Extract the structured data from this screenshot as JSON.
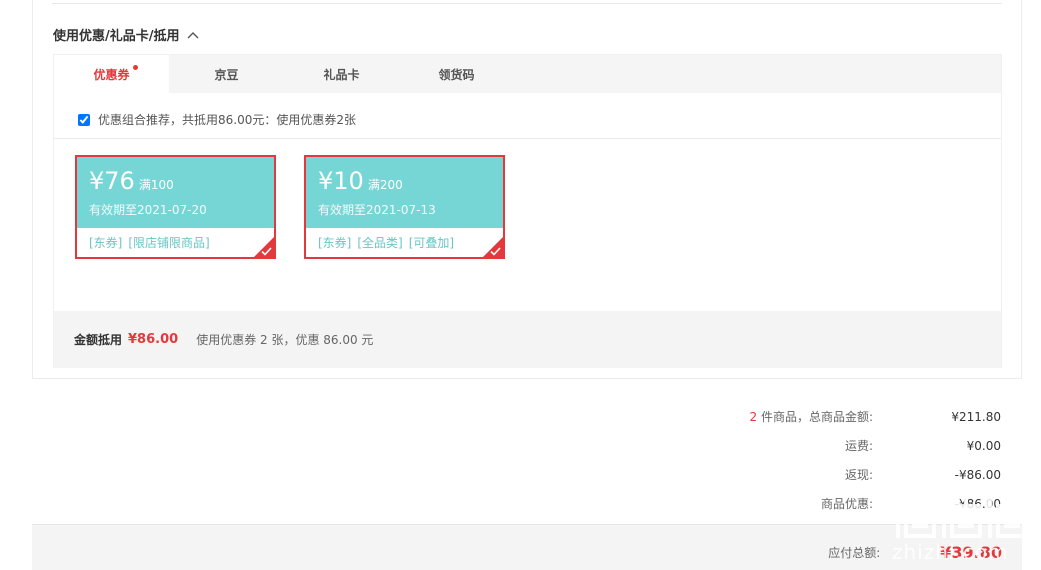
{
  "section": {
    "title": "使用优惠/礼品卡/抵用"
  },
  "tabs": [
    {
      "label": "优惠券",
      "active": true
    },
    {
      "label": "京豆"
    },
    {
      "label": "礼品卡"
    },
    {
      "label": "领货码"
    }
  ],
  "combo": {
    "text": "优惠组合推荐，共抵用86.00元：使用优惠券2张",
    "checked": true
  },
  "coupons": [
    {
      "amount": "¥76",
      "condition": "满100",
      "valid": "有效期至2021-07-20",
      "tags": [
        "[东券]",
        "[限店铺限商品]"
      ]
    },
    {
      "amount": "¥10",
      "condition": "满200",
      "valid": "有效期至2021-07-13",
      "tags": [
        "[东券]",
        "[全品类]",
        "[可叠加]"
      ]
    }
  ],
  "summary": {
    "label": "金额抵用",
    "amount": "¥86.00",
    "desc": "使用优惠券 2 张，优惠 86.00 元"
  },
  "totals": {
    "count": "2",
    "items_label": " 件商品，总商品金额:",
    "items_value": "¥211.80",
    "shipping_label": "运费:",
    "shipping_value": "¥0.00",
    "rebate_label": "返现:",
    "rebate_value": "-¥86.00",
    "discount_label": "商品优惠:",
    "discount_value": "-¥86.00"
  },
  "pay": {
    "label": "应付总额:",
    "value": "¥39.80"
  },
  "watermark": {
    "text": "zhizhi.com"
  },
  "colors": {
    "accent": "#e4393c",
    "coupon": "#76d6d6",
    "tag": "#69c6c6"
  }
}
